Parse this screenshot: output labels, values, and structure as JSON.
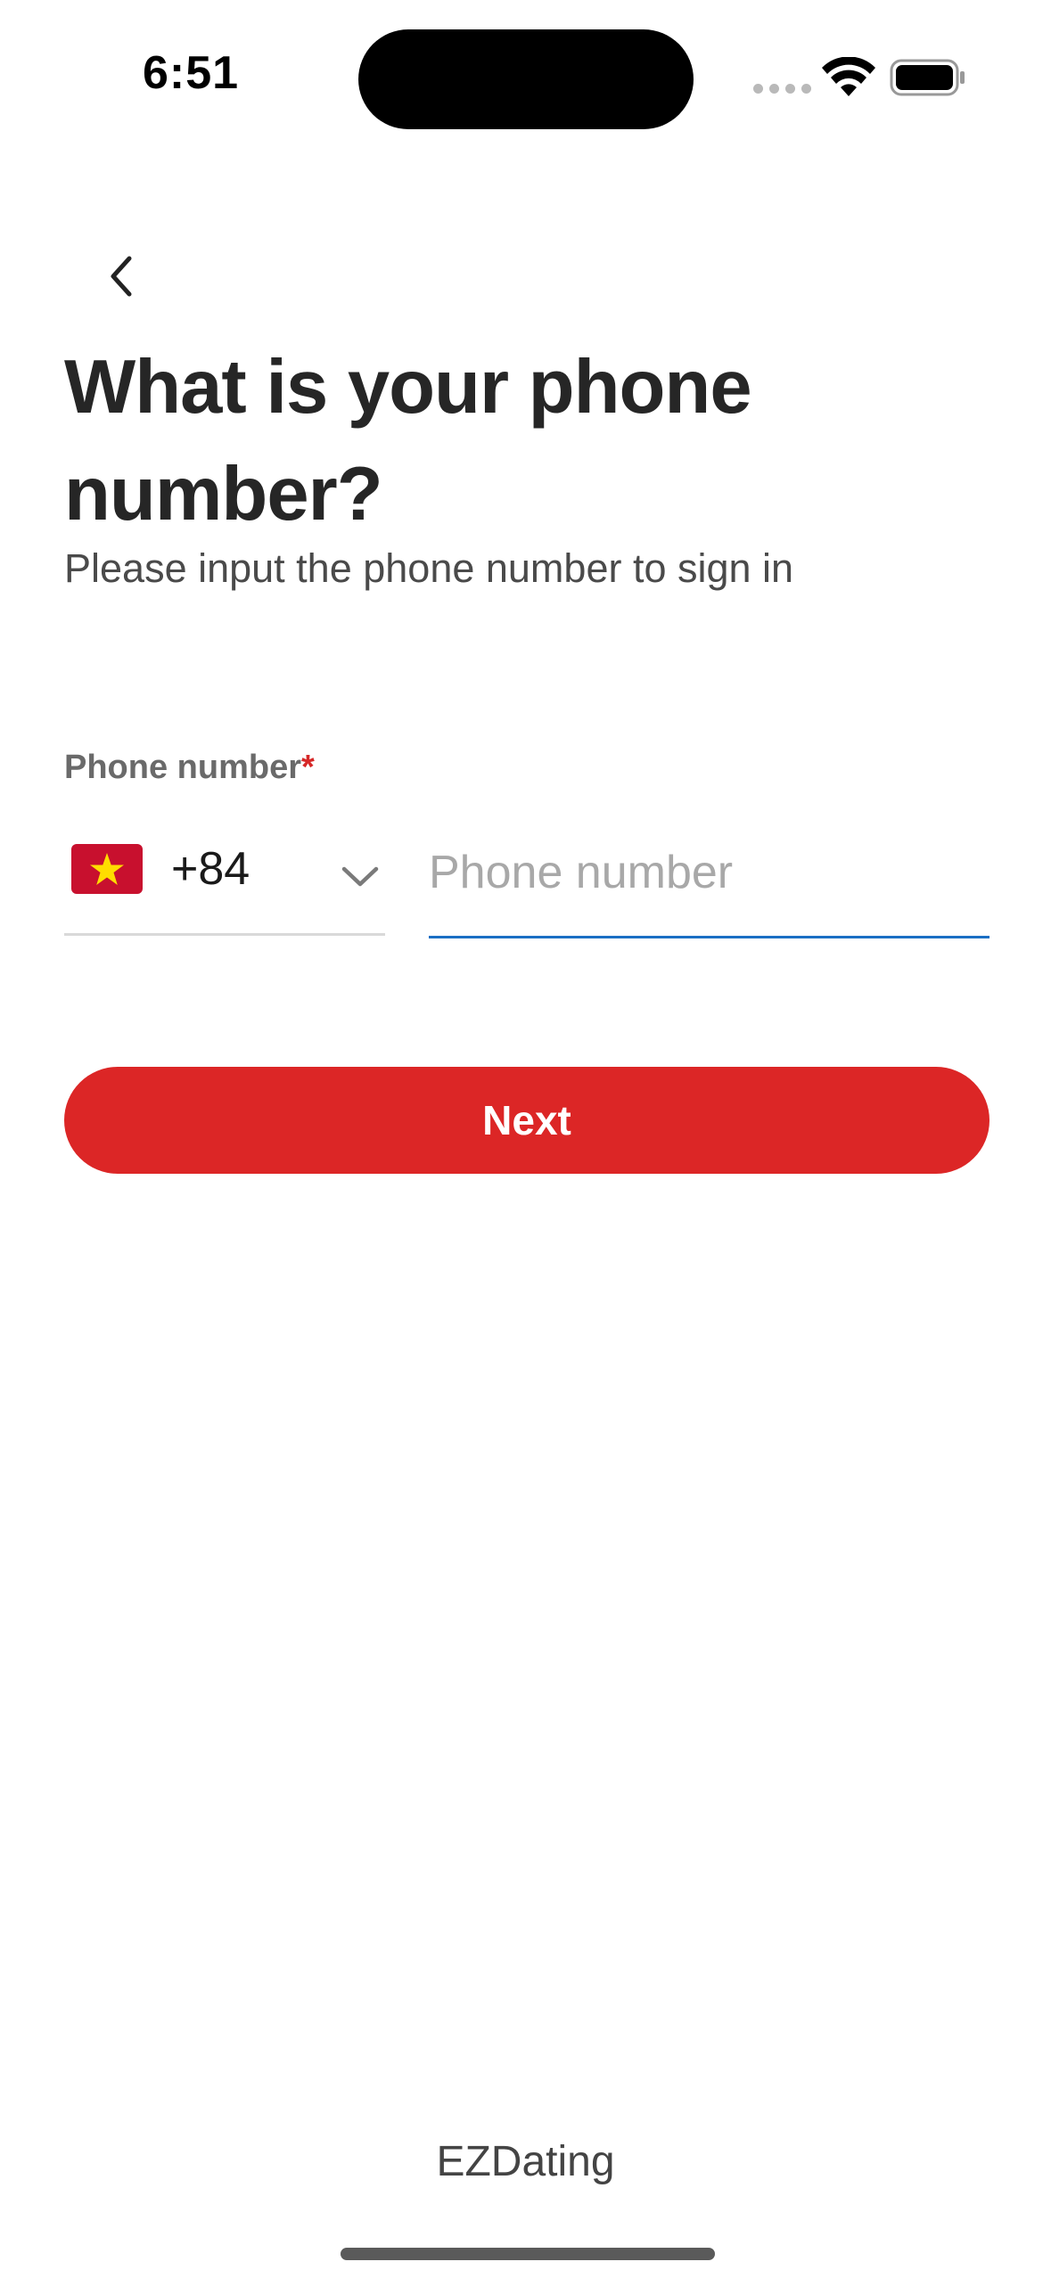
{
  "status_bar": {
    "time": "6:51",
    "icons": [
      "cellular-dots-icon",
      "wifi-icon",
      "battery-icon"
    ]
  },
  "header": {
    "back_icon": "chevron-left-icon",
    "title": "What is your phone number?",
    "subtitle": "Please input the phone number to sign in"
  },
  "form": {
    "label": "Phone number",
    "required_mark": "*",
    "country": {
      "flag_icon": "vietnam-flag-icon",
      "code": "+84",
      "dropdown_icon": "chevron-down-icon"
    },
    "phone_placeholder": "Phone number",
    "phone_value": ""
  },
  "actions": {
    "next_label": "Next"
  },
  "footer": {
    "app_name": "EZDating"
  },
  "colors": {
    "accent": "#dc2626",
    "input_focus": "#1a6fc4",
    "required": "#d62828"
  }
}
